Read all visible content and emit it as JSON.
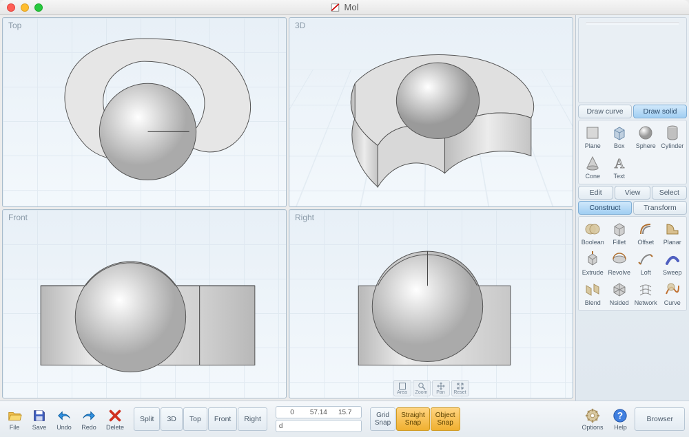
{
  "window": {
    "title": "Mol"
  },
  "viewports": [
    {
      "label": "Top"
    },
    {
      "label": "3D"
    },
    {
      "label": "Front"
    },
    {
      "label": "Right"
    }
  ],
  "vp_nav": [
    {
      "label": "Area"
    },
    {
      "label": "Zoom"
    },
    {
      "label": "Pan"
    },
    {
      "label": "Reset"
    }
  ],
  "sidebar": {
    "draw_tabs": [
      {
        "label": "Draw curve",
        "active": false
      },
      {
        "label": "Draw solid",
        "active": true
      }
    ],
    "solid_tools": [
      {
        "label": "Plane"
      },
      {
        "label": "Box"
      },
      {
        "label": "Sphere"
      },
      {
        "label": "Cylinder"
      },
      {
        "label": "Cone"
      },
      {
        "label": "Text"
      }
    ],
    "mode_buttons": [
      {
        "label": "Edit"
      },
      {
        "label": "View"
      },
      {
        "label": "Select"
      }
    ],
    "xform_tabs": [
      {
        "label": "Construct",
        "active": true
      },
      {
        "label": "Transform",
        "active": false
      }
    ],
    "construct_tools": [
      {
        "label": "Boolean"
      },
      {
        "label": "Fillet"
      },
      {
        "label": "Offset"
      },
      {
        "label": "Planar"
      },
      {
        "label": "Extrude"
      },
      {
        "label": "Revolve"
      },
      {
        "label": "Loft"
      },
      {
        "label": "Sweep"
      },
      {
        "label": "Blend"
      },
      {
        "label": "Nsided"
      },
      {
        "label": "Network"
      },
      {
        "label": "Curve"
      }
    ]
  },
  "footer": {
    "file_buttons": [
      {
        "label": "File"
      },
      {
        "label": "Save"
      },
      {
        "label": "Undo"
      },
      {
        "label": "Redo"
      },
      {
        "label": "Delete"
      }
    ],
    "view_buttons": [
      {
        "label": "Split"
      },
      {
        "label": "3D"
      },
      {
        "label": "Top"
      },
      {
        "label": "Front"
      },
      {
        "label": "Right"
      }
    ],
    "coords": {
      "x": "0",
      "y": "57.14",
      "z": "15.7",
      "d_prefix": "d"
    },
    "snap_buttons": [
      {
        "label": "Grid Snap",
        "active": false
      },
      {
        "label": "Straight Snap",
        "active": true
      },
      {
        "label": "Object Snap",
        "active": true
      }
    ],
    "right_buttons": [
      {
        "label": "Options"
      },
      {
        "label": "Help"
      }
    ],
    "browser_label": "Browser"
  }
}
